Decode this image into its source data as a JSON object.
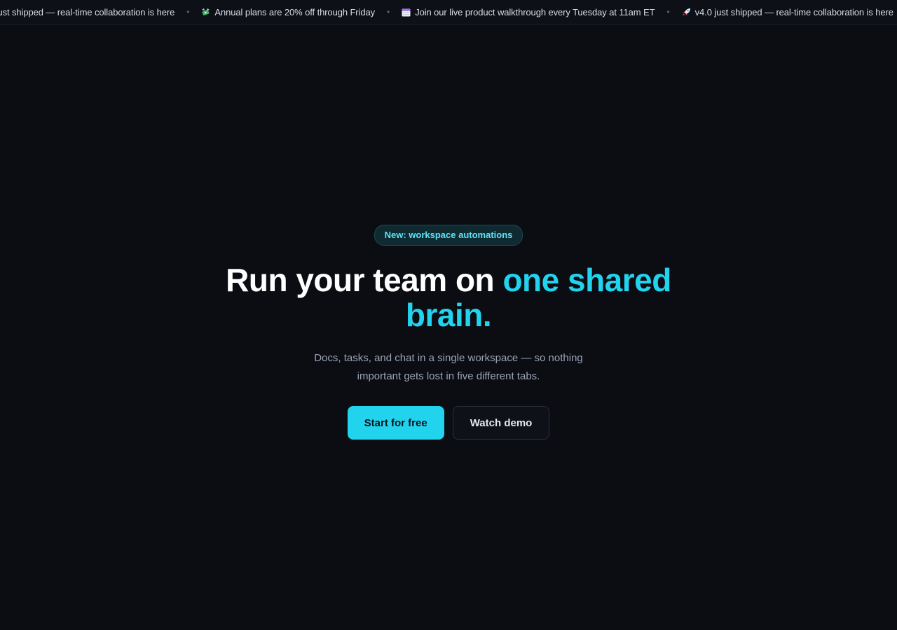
{
  "ticker": {
    "items": [
      {
        "icon": "rocket-icon",
        "text": "v4.0 just shipped — real-time collaboration is here"
      },
      {
        "icon": "money-with-wings-icon",
        "text": "Annual plans are 20% off through Friday"
      },
      {
        "icon": "calendar-icon",
        "text": "Join our live product walkthrough every Tuesday at 11am ET"
      },
      {
        "icon": "rocket-icon",
        "text": "v4.0 just shipped — real-time collaboration is here"
      }
    ],
    "separator": "•"
  },
  "hero": {
    "badge": "New: workspace automations",
    "headline_plain": "Run your team on ",
    "headline_accent": "one shared brain.",
    "subtitle": "Docs, tasks, and chat in a single workspace — so nothing important gets lost in five different tabs.",
    "primary_cta": "Start for free",
    "secondary_cta": "Watch demo"
  },
  "colors": {
    "background": "#0b0d13",
    "accent": "#22d3ee",
    "badge_text": "#5ee3f5",
    "subtitle_text": "#9aa3b5"
  }
}
